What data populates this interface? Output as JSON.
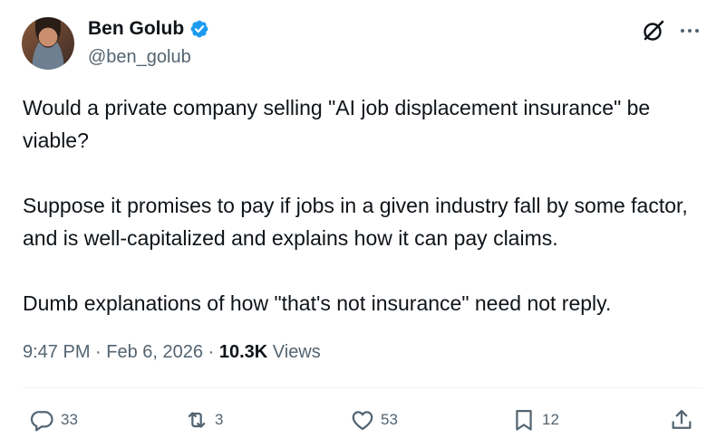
{
  "author": {
    "name": "Ben Golub",
    "handle": "@ben_golub",
    "verified_color": "#1d9bf0"
  },
  "icons": {
    "grok": "grok-icon",
    "more": "more-icon",
    "reply": "reply-icon",
    "repost": "repost-icon",
    "like": "heart-icon",
    "bookmark": "bookmark-icon",
    "share": "share-icon"
  },
  "tweet": {
    "paragraphs": [
      "Would a private company selling \"AI job displacement insurance\" be viable?",
      "Suppose it promises to pay if jobs in a given industry fall by some factor, and is well-capitalized and explains how it can pay claims.",
      "Dumb explanations of how \"that's not insurance\" need not reply."
    ]
  },
  "meta": {
    "time": "9:47 PM",
    "separator": "·",
    "date": "Feb 6, 2026",
    "views_count": "10.3K",
    "views_label": "Views"
  },
  "actions": {
    "replies": "33",
    "reposts": "3",
    "likes": "53",
    "bookmarks": "12"
  },
  "colors": {
    "text": "#0f1419",
    "secondary": "#536471",
    "divider": "#eff3f4"
  }
}
